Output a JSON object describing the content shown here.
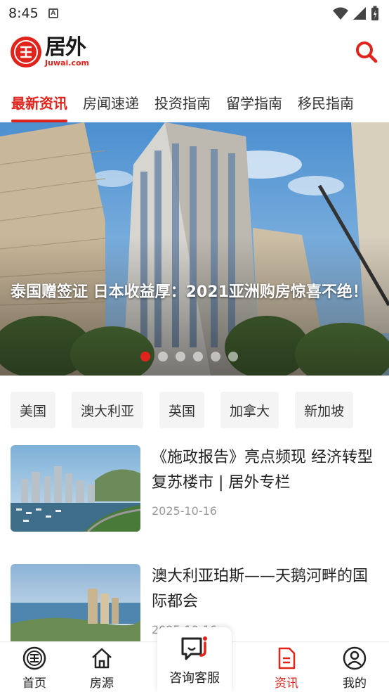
{
  "status": {
    "time": "8:45"
  },
  "header": {
    "logo_cn": "居外",
    "logo_en": "Juwai.com"
  },
  "tabs": [
    {
      "label": "最新资讯",
      "active": true
    },
    {
      "label": "房闻速递"
    },
    {
      "label": "投资指南"
    },
    {
      "label": "留学指南"
    },
    {
      "label": "移民指南"
    }
  ],
  "banner": {
    "title": "泰国赠签证 日本收益厚：2021亚洲购房惊喜不绝！",
    "slide_count": 6,
    "active_slide": 1
  },
  "countries": [
    "美国",
    "澳大利亚",
    "英国",
    "加拿大",
    "新加坡"
  ],
  "articles": [
    {
      "title": "《施政报告》亮点频现 经济转型复苏楼市 | 居外专栏",
      "date": "2025-10-16"
    },
    {
      "title": "澳大利亚珀斯——天鹅河畔的国际都会",
      "date": "2025-10-16"
    }
  ],
  "bottom_nav": {
    "home": "首页",
    "listings": "房源",
    "consult": "咨询客服",
    "news": "资讯",
    "me": "我的"
  },
  "colors": {
    "brand": "#e0241b"
  }
}
